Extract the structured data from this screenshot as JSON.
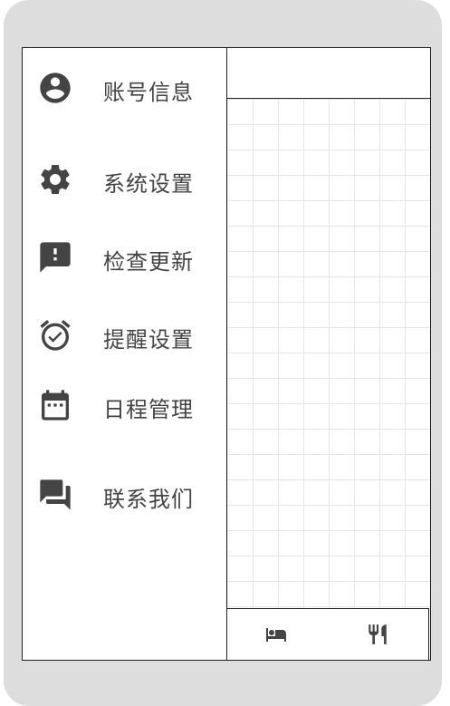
{
  "menu": {
    "items": [
      {
        "label": "账号信息",
        "icon": "account-circle-icon"
      },
      {
        "label": "系统设置",
        "icon": "gear-icon"
      },
      {
        "label": "检查更新",
        "icon": "feedback-alert-icon"
      },
      {
        "label": "提醒设置",
        "icon": "alarm-check-icon"
      },
      {
        "label": "日程管理",
        "icon": "calendar-icon"
      },
      {
        "label": "联系我们",
        "icon": "chat-icon"
      }
    ]
  },
  "bottom_nav": {
    "tabs": [
      {
        "icon": "bed-icon"
      },
      {
        "icon": "restaurant-icon"
      }
    ]
  },
  "colors": {
    "icon": "#444444",
    "text": "#444444",
    "frame": "#dddddd",
    "grid": "#e6e6e6"
  }
}
